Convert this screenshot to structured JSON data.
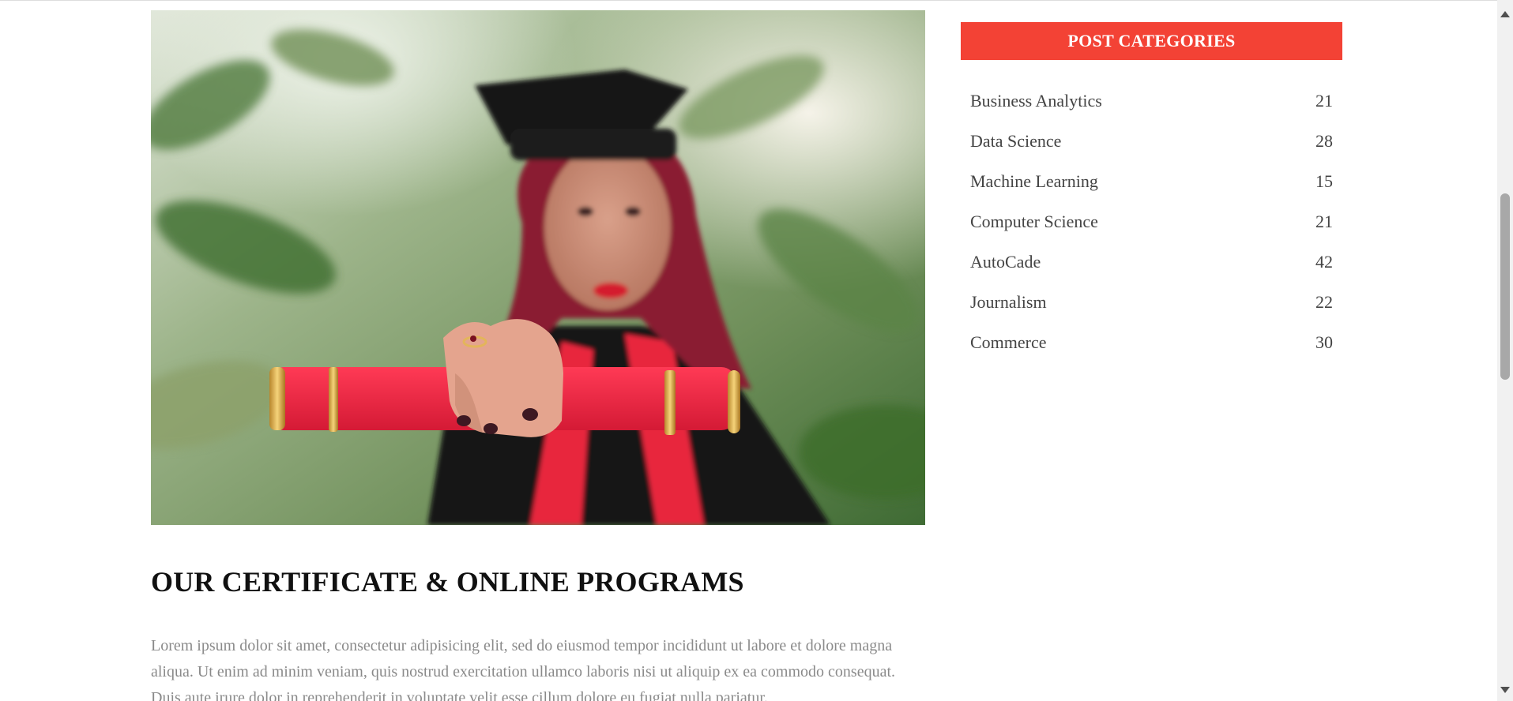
{
  "article": {
    "title": "OUR CERTIFICATE & ONLINE PROGRAMS",
    "body": "Lorem ipsum dolor sit amet, consectetur adipisicing elit, sed do eiusmod tempor incididunt ut labore et dolore magna aliqua. Ut enim ad minim veniam, quis nostrud exercitation ullamco laboris nisi ut aliquip ex ea commodo consequat. Duis aute irure dolor in reprehenderit in voluptate velit esse cillum dolore eu fugiat nulla pariatur."
  },
  "sidebar": {
    "header": "POST CATEGORIES",
    "categories": [
      {
        "name": "Business Analytics",
        "count": "21"
      },
      {
        "name": "Data Science",
        "count": "28"
      },
      {
        "name": "Machine Learning",
        "count": "15"
      },
      {
        "name": "Computer Science",
        "count": "21"
      },
      {
        "name": "AutoCade",
        "count": "42"
      },
      {
        "name": "Journalism",
        "count": "22"
      },
      {
        "name": "Commerce",
        "count": "30"
      }
    ]
  },
  "colors": {
    "accent": "#f34235",
    "title": "#111111",
    "body_text": "#8a8a8a",
    "category_text": "#444444"
  }
}
